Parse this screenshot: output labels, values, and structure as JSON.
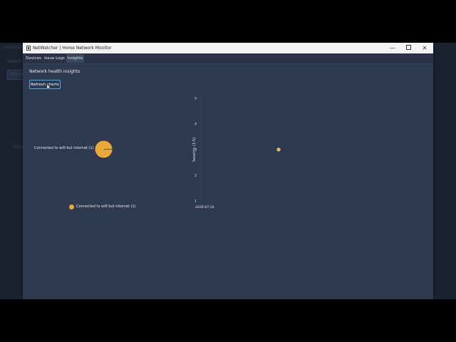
{
  "background_app": {
    "labels": [
      "Dashboard",
      "Network",
      "Refresh",
      "Connection"
    ]
  },
  "window": {
    "title": "NetWatcher | Home Network Monitor",
    "controls": {
      "minimize": "—",
      "close": "✕"
    }
  },
  "tabs": [
    {
      "label": "Devices",
      "active": false
    },
    {
      "label": "Issue Logs",
      "active": false
    },
    {
      "label": "Insights",
      "active": true
    }
  ],
  "insights": {
    "heading": "Network health insights",
    "refresh_label": "Refresh charts"
  },
  "colors": {
    "accent": "#e9a93a",
    "panel": "#2f3a50",
    "button_border": "#5aa7d8"
  },
  "chart_data": [
    {
      "type": "pie",
      "slices": [
        {
          "label": "Connected to wifi but internet (1)",
          "value": 1
        }
      ],
      "legend": [
        "Connected to wifi but internet (1)"
      ],
      "legend_placement": "bottom"
    },
    {
      "type": "scatter",
      "ylabel": "Severity (1-5)",
      "xlabel": "",
      "x_ticks": [
        "2026-07-24"
      ],
      "y_ticks": [
        1,
        2,
        3,
        4,
        5
      ],
      "ylim": [
        1,
        5
      ],
      "points": [
        {
          "x": "2026-07-24",
          "y": 3
        }
      ],
      "grid": false
    }
  ]
}
